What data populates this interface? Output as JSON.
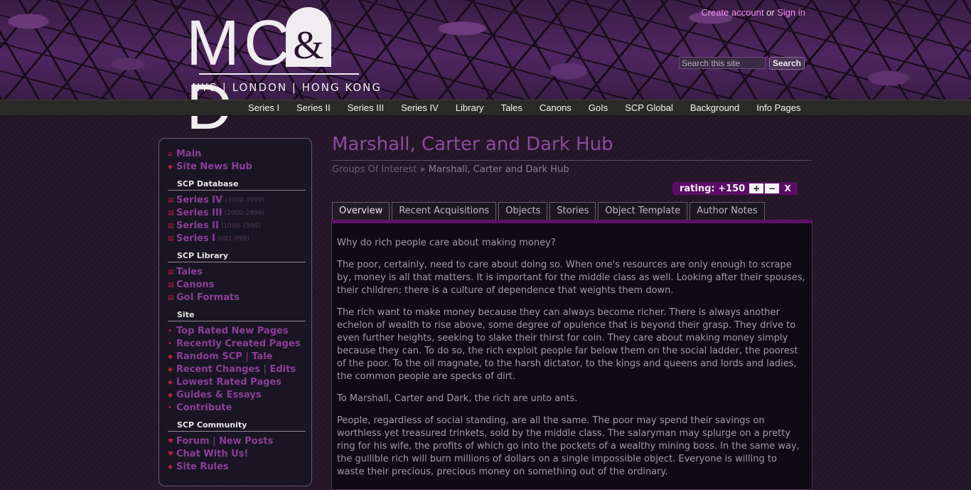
{
  "header": {
    "logo": {
      "letters": "MC&D",
      "cities": "NYC | LONDON | HONG KONG"
    },
    "account": {
      "create_account": "Create account",
      "or": "or",
      "sign_in": "Sign in"
    },
    "search": {
      "placeholder": "Search this site",
      "button": "Search"
    }
  },
  "topnav": {
    "items": [
      "Series I",
      "Series II",
      "Series III",
      "Series IV",
      "Library",
      "Tales",
      "Canons",
      "GoIs",
      "SCP Global",
      "Background",
      "Info Pages"
    ]
  },
  "sidebar": {
    "main": "Main",
    "site_news": "Site News Hub",
    "scp_database": {
      "heading": "SCP Database",
      "items": [
        {
          "label": "Series IV",
          "range": "(3000-3999)"
        },
        {
          "label": "Series III",
          "range": "(2000-2999)"
        },
        {
          "label": "Series II",
          "range": "(1000-1999)"
        },
        {
          "label": "Series I",
          "range": "(001-999)"
        }
      ]
    },
    "scp_library": {
      "heading": "SCP Library",
      "items": [
        "Tales",
        "Canons",
        "GoI Formats"
      ]
    },
    "site": {
      "heading": "Site",
      "top_rated": "Top Rated New Pages",
      "recently_created": "Recently Created Pages",
      "random_scp": "Random SCP",
      "tale": "Tale",
      "recent_changes": "Recent Changes",
      "edits": "Edits",
      "lowest_rated": "Lowest Rated Pages",
      "guides": "Guides & Essays",
      "contribute": "Contribute",
      "separator": "|"
    },
    "scp_community": {
      "heading": "SCP Community",
      "forum": "Forum",
      "new_posts": "New Posts",
      "chat": "Chat With Us!",
      "rules": "Site Rules"
    }
  },
  "page": {
    "title": "Marshall, Carter and Dark Hub",
    "breadcrumb": {
      "parent": "Groups Of Interest",
      "separator": "»",
      "current": "Marshall, Carter and Dark Hub"
    },
    "rating": {
      "label": "rating: +150",
      "up": "+",
      "down": "−",
      "cancel": "X"
    },
    "tabs": [
      "Overview",
      "Recent Acquisitions",
      "Objects",
      "Stories",
      "Object Template",
      "Author Notes"
    ],
    "active_tab": "Overview",
    "paragraphs": [
      "Why do rich people care about making money?",
      "The poor, certainly, need to care about doing so. When one's resources are only enough to scrape by, money is all that matters. It is important for the middle class as well. Looking after their spouses, their children; there is a culture of dependence that weights them down.",
      "The rich want to make money because they can always become richer. There is always another echelon of wealth to rise above, some degree of opulence that is beyond their grasp. They drive to even further heights, seeking to slake their thirst for coin. They care about making money simply because they can. To do so, the rich exploit people far below them on the social ladder, the poorest of the poor. To the oil magnate, to the harsh dictator, to the kings and queens and lords and ladies, the common people are specks of dirt.",
      "To Marshall, Carter and Dark, the rich are unto ants.",
      "People, regardless of social standing, are all the same. The poor may spend their savings on worthless yet treasured trinkets, sold by the middle class. The salaryman may splurge on a pretty ring for his wife, the profits of which go into the pockets of a wealthy mining boss. In the same way, the gullible rich will burn millions of dollars on a single impossible object. Everyone is willing to waste their precious, precious money on something out of the ordinary."
    ]
  },
  "colors": {
    "accent": "#8a3e98",
    "tab_bar": "#5e1068",
    "rating_bg": "#5a0d64",
    "bullet": "#b0223a"
  }
}
